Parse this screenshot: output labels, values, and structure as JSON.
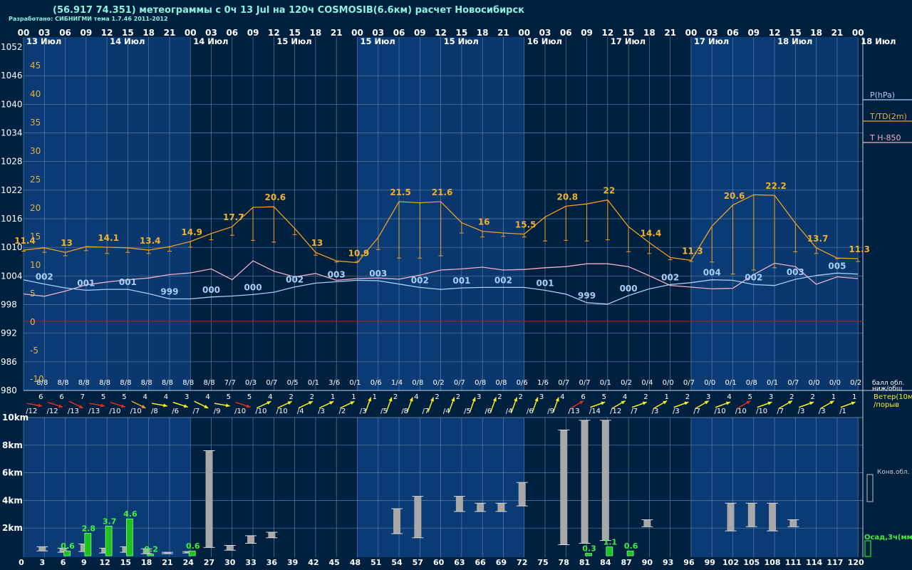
{
  "header": {
    "title": "(56.917 74.351) метеограммы с  0ч 13 Jul на 120ч COSMOSIB(6.6км) расчет Новосибирск",
    "credit": "Разработано: СИБНИГМИ тема 1.7.46 2011-2012"
  },
  "colors": {
    "background": "#00203f",
    "day_band": "#0b3b75",
    "grid": "#5b7fa5",
    "pressure": "#a8cef5",
    "temperature": "#f0a020",
    "t850": "#f0b0c8",
    "zero_line": "#a02020",
    "wind_arrow": "#f8f020",
    "wind_arrow_strong": "#e03020",
    "wind_arrow_mid": "#e8a020",
    "cloud_bar": "#a8a8a8",
    "precip_bar": "#20c020",
    "axis_text": "#ffffff",
    "pressure_label": "#a8d0f8",
    "temperature_label": "#f0b030"
  },
  "chart_data": {
    "type": "line",
    "x_hours": [
      0,
      3,
      6,
      9,
      12,
      15,
      18,
      21,
      24,
      27,
      30,
      33,
      36,
      39,
      42,
      45,
      48,
      51,
      54,
      57,
      60,
      63,
      66,
      69,
      72,
      75,
      78,
      81,
      84,
      87,
      90,
      93,
      96,
      99,
      102,
      105,
      108,
      111,
      114,
      117,
      120
    ],
    "time_ticks_top": [
      "00",
      "03",
      "06",
      "09",
      "12",
      "15",
      "18",
      "21",
      "00",
      "03",
      "06",
      "09",
      "12",
      "15",
      "18",
      "21",
      "00",
      "03",
      "06",
      "09",
      "12",
      "15",
      "18",
      "21",
      "00",
      "03",
      "06",
      "09",
      "12",
      "15",
      "18",
      "21",
      "00",
      "03",
      "06",
      "09",
      "12",
      "15",
      "18",
      "21",
      "00"
    ],
    "date_labels": [
      {
        "hour": 1.5,
        "text": "13 Июл"
      },
      {
        "hour": 13.5,
        "text": "14 Июл"
      },
      {
        "hour": 25.5,
        "text": "14 Июл"
      },
      {
        "hour": 37.5,
        "text": "15 Июл"
      },
      {
        "hour": 49.5,
        "text": "15 Июл"
      },
      {
        "hour": 61.5,
        "text": "15 Июл"
      },
      {
        "hour": 73.5,
        "text": "16 Июл"
      },
      {
        "hour": 85.5,
        "text": "17 Июл"
      },
      {
        "hour": 97.5,
        "text": "17 Июл"
      },
      {
        "hour": 109.5,
        "text": "18 Июл"
      },
      {
        "hour": 121.5,
        "text": "18 Июл"
      }
    ],
    "pressure_axis": {
      "min": 980,
      "max": 1052,
      "step": 6,
      "ticks": [
        "1052",
        "1046",
        "1040",
        "1034",
        "1028",
        "1022",
        "1016",
        "1010",
        "1004",
        "998",
        "992",
        "986",
        "980"
      ]
    },
    "temperature_axis": {
      "min": -10,
      "max": 45,
      "step": 5,
      "ticks": [
        "45",
        "40",
        "35",
        "30",
        "25",
        "20",
        "15",
        "10",
        "5",
        "0",
        "-5",
        "-10"
      ]
    },
    "legend": [
      "P(hPa)",
      "T/TD(2m)",
      "T H-850"
    ],
    "pressure_hPa": [
      1003.2,
      1002.3,
      1001.5,
      1001,
      1001.2,
      1001.2,
      1000.3,
      999.2,
      999.2,
      999.6,
      999.8,
      1000.1,
      1000.6,
      1001.7,
      1002.5,
      1002.8,
      1003.1,
      1003,
      1002.3,
      1001.6,
      1001.2,
      1001.5,
      1001.6,
      1001.6,
      1001.6,
      1001,
      1000.2,
      998.4,
      998.1,
      999.9,
      1001.3,
      1002.2,
      1002.6,
      1003.2,
      1003.1,
      1002.2,
      1002,
      1003.3,
      1004.1,
      1004.6,
      1004.4
    ],
    "pressure_labels": [
      {
        "hour": 3,
        "text": "002"
      },
      {
        "hour": 9,
        "text": "001"
      },
      {
        "hour": 15,
        "text": "001"
      },
      {
        "hour": 21,
        "text": "999"
      },
      {
        "hour": 27,
        "text": "000"
      },
      {
        "hour": 33,
        "text": "000"
      },
      {
        "hour": 39,
        "text": "002"
      },
      {
        "hour": 45,
        "text": "003"
      },
      {
        "hour": 51,
        "text": "003"
      },
      {
        "hour": 57,
        "text": "002"
      },
      {
        "hour": 63,
        "text": "001"
      },
      {
        "hour": 69,
        "text": "002"
      },
      {
        "hour": 75,
        "text": "001"
      },
      {
        "hour": 81,
        "text": "999"
      },
      {
        "hour": 87,
        "text": "000"
      },
      {
        "hour": 93,
        "text": "002"
      },
      {
        "hour": 99,
        "text": "004"
      },
      {
        "hour": 105,
        "text": "002"
      },
      {
        "hour": 111,
        "text": "003"
      },
      {
        "hour": 117,
        "text": "005"
      }
    ],
    "temperature_2m": [
      12.5,
      12.9,
      12.1,
      13.1,
      13.0,
      12.9,
      12.5,
      13.1,
      14.0,
      15.4,
      16.6,
      20.0,
      20.1,
      16.3,
      12.1,
      10.6,
      10.3,
      14.7,
      21.0,
      20.8,
      21.0,
      17.3,
      15.8,
      15.5,
      15.3,
      18.3,
      20.2,
      20.6,
      21.3,
      16.6,
      13.8,
      11.2,
      10.7,
      16.7,
      20.4,
      22.2,
      22.1,
      17.2,
      12.9,
      11.1,
      11.0
    ],
    "dewpoint_2m": [
      12.3,
      12.1,
      11.5,
      12.4,
      11.9,
      12.1,
      11.9,
      12.3,
      13.0,
      14.3,
      15.1,
      14.2,
      13.9,
      15.2,
      11.6,
      10.4,
      10.5,
      12.6,
      11.1,
      11.1,
      11.5,
      15.5,
      14.8,
      14.9,
      14.8,
      14.1,
      14.2,
      14.1,
      14.3,
      12.2,
      11.9,
      10.8,
      10.5,
      10.4,
      8.3,
      9.0,
      9.4,
      12.2,
      11.9,
      11.0,
      10.5
    ],
    "temperature_labels": [
      {
        "hour": 0,
        "text": "11.4"
      },
      {
        "hour": 6,
        "text": "13"
      },
      {
        "hour": 12,
        "text": "14.1"
      },
      {
        "hour": 18,
        "text": "13.4"
      },
      {
        "hour": 24,
        "text": "14.9"
      },
      {
        "hour": 30,
        "text": "17.7"
      },
      {
        "hour": 36,
        "text": "20.6"
      },
      {
        "hour": 42,
        "text": "13"
      },
      {
        "hour": 48,
        "text": "10.9"
      },
      {
        "hour": 54,
        "text": "21.5"
      },
      {
        "hour": 60,
        "text": "21.6"
      },
      {
        "hour": 66,
        "text": "16"
      },
      {
        "hour": 72,
        "text": "15.5"
      },
      {
        "hour": 78,
        "text": "20.8"
      },
      {
        "hour": 84,
        "text": "22"
      },
      {
        "hour": 90,
        "text": "14.4"
      },
      {
        "hour": 96,
        "text": "11.3"
      },
      {
        "hour": 102,
        "text": "20.6"
      },
      {
        "hour": 108,
        "text": "22.2"
      },
      {
        "hour": 114,
        "text": "13.7"
      },
      {
        "hour": 120,
        "text": "11.3"
      }
    ],
    "temperature_850": [
      4.8,
      4.4,
      5.3,
      6.4,
      6.9,
      7.3,
      7.6,
      8.2,
      8.5,
      9.2,
      7.3,
      10.6,
      8.8,
      7.8,
      8.4,
      7.2,
      7.5,
      7.6,
      7.4,
      8.1,
      9.0,
      9.2,
      9.5,
      9.0,
      9.1,
      9.4,
      9.6,
      10.1,
      10.1,
      9.6,
      8.0,
      6.3,
      6.0,
      5.7,
      5.8,
      8.2,
      10.2,
      9.6,
      6.5,
      7.8,
      7.5
    ],
    "cloud_cover": [
      "8/8",
      "8/8",
      "8/8",
      "8/8",
      "8/8",
      "8/8",
      "8/8",
      "8/8",
      "8/8",
      "8/8",
      "7/7",
      "0/3",
      "0/7",
      "0/5",
      "0/1",
      "3/6",
      "0/1",
      "0/6",
      "1/4",
      "0/8",
      "0/2",
      "0/7",
      "0/8",
      "0/8",
      "0/6",
      "1/6",
      "0/7",
      "0/7",
      "0/1",
      "0/2",
      "0/4",
      "0/0",
      "0/7",
      "0/0",
      "0/1",
      "0/8",
      "0/1",
      "0/7",
      "0/0",
      "0/0",
      "0/2"
    ],
    "cloud_label": "балл обл.\nниж/общ",
    "wind": [
      {
        "hour": 3,
        "speed": "6",
        "gust": "/12",
        "level": "strong"
      },
      {
        "hour": 6,
        "speed": "6",
        "gust": "/12",
        "level": "strong"
      },
      {
        "hour": 9,
        "speed": "7",
        "gust": "/13",
        "level": "strong"
      },
      {
        "hour": 12,
        "speed": "5",
        "gust": "/13",
        "level": "strong"
      },
      {
        "hour": 15,
        "speed": "5",
        "gust": "/10",
        "level": "strong"
      },
      {
        "hour": 18,
        "speed": "4",
        "gust": "/10",
        "level": "mid"
      },
      {
        "hour": 21,
        "speed": "4",
        "gust": "/8",
        "level": "normal"
      },
      {
        "hour": 24,
        "speed": "3",
        "gust": "/6",
        "level": "normal"
      },
      {
        "hour": 27,
        "speed": "4",
        "gust": "/7",
        "level": "normal"
      },
      {
        "hour": 30,
        "speed": "5",
        "gust": "/9",
        "level": "normal"
      },
      {
        "hour": 33,
        "speed": "5",
        "gust": "/10",
        "level": "strong"
      },
      {
        "hour": 36,
        "speed": "4",
        "gust": "/10",
        "level": "normal"
      },
      {
        "hour": 39,
        "speed": "2",
        "gust": "/10",
        "level": "normal"
      },
      {
        "hour": 42,
        "speed": "2",
        "gust": "/4",
        "level": "normal"
      },
      {
        "hour": 45,
        "speed": "1",
        "gust": "/3",
        "level": "normal"
      },
      {
        "hour": 48,
        "speed": "1",
        "gust": "/2",
        "level": "normal"
      },
      {
        "hour": 51,
        "speed": "1",
        "gust": "/3",
        "level": "normal"
      },
      {
        "hour": 54,
        "speed": "2",
        "gust": "/5",
        "level": "normal"
      },
      {
        "hour": 57,
        "speed": "4",
        "gust": "/8",
        "level": "normal"
      },
      {
        "hour": 60,
        "speed": "2",
        "gust": "/7",
        "level": "normal"
      },
      {
        "hour": 63,
        "speed": "2",
        "gust": "/4",
        "level": "normal"
      },
      {
        "hour": 66,
        "speed": "3",
        "gust": "/5",
        "level": "normal"
      },
      {
        "hour": 69,
        "speed": "2",
        "gust": "/6",
        "level": "normal"
      },
      {
        "hour": 72,
        "speed": "2",
        "gust": "/4",
        "level": "normal"
      },
      {
        "hour": 75,
        "speed": "3",
        "gust": "/6",
        "level": "normal"
      },
      {
        "hour": 78,
        "speed": "4",
        "gust": "/9",
        "level": "normal"
      },
      {
        "hour": 81,
        "speed": "6",
        "gust": "/13",
        "level": "strong"
      },
      {
        "hour": 84,
        "speed": "5",
        "gust": "/14",
        "level": "normal"
      },
      {
        "hour": 87,
        "speed": "4",
        "gust": "/12",
        "level": "normal"
      },
      {
        "hour": 90,
        "speed": "2",
        "gust": "/7",
        "level": "normal"
      },
      {
        "hour": 93,
        "speed": "1",
        "gust": "/3",
        "level": "normal"
      },
      {
        "hour": 96,
        "speed": "2",
        "gust": "/3",
        "level": "normal"
      },
      {
        "hour": 99,
        "speed": "3",
        "gust": "/7",
        "level": "normal"
      },
      {
        "hour": 102,
        "speed": "4",
        "gust": "/10",
        "level": "normal"
      },
      {
        "hour": 105,
        "speed": "5",
        "gust": "/10",
        "level": "strong"
      },
      {
        "hour": 108,
        "speed": "3",
        "gust": "/10",
        "level": "normal"
      },
      {
        "hour": 111,
        "speed": "2",
        "gust": "/7",
        "level": "normal"
      },
      {
        "hour": 114,
        "speed": "2",
        "gust": "/3",
        "level": "normal"
      },
      {
        "hour": 117,
        "speed": "1",
        "gust": "/3",
        "level": "normal"
      },
      {
        "hour": 120,
        "speed": "1",
        "gust": "/1",
        "level": "normal"
      }
    ],
    "wind_label": "Ветер(10м)\n/порыв",
    "height_axis": {
      "min": 0,
      "max": 10,
      "unit": "km",
      "ticks": [
        "10km",
        "8km",
        "6km",
        "4km",
        "2km"
      ]
    },
    "convective_cloud_label": "Конв.обл.",
    "precip_label": "Осад,3ч(мм)",
    "bottom_hour_labels": [
      "0",
      "3",
      "6",
      "9",
      "12",
      "15",
      "18",
      "21",
      "24",
      "27",
      "30",
      "33",
      "36",
      "39",
      "42",
      "45",
      "48",
      "51",
      "54",
      "57",
      "60",
      "63",
      "66",
      "69",
      "72",
      "75",
      "78",
      "81",
      "84",
      "87",
      "90",
      "93",
      "96",
      "99",
      "102",
      "105",
      "108",
      "111",
      "114",
      "117",
      "120"
    ],
    "convective_clouds_km": [
      {
        "hour": 3,
        "base": 0.35,
        "top": 0.65
      },
      {
        "hour": 6,
        "base": 0.25,
        "top": 0.55
      },
      {
        "hour": 9,
        "base": 0.3,
        "top": 0.85
      },
      {
        "hour": 12,
        "base": 0.2,
        "top": 0.55
      },
      {
        "hour": 15,
        "base": 0.25,
        "top": 0.65
      },
      {
        "hour": 18,
        "base": 0.15,
        "top": 0.5
      },
      {
        "hour": 21,
        "base": 0.15,
        "top": 0.25
      },
      {
        "hour": 24,
        "base": 0.2,
        "top": 0.3
      },
      {
        "hour": 27,
        "base": 0.6,
        "top": 7.6
      },
      {
        "hour": 30,
        "base": 0.4,
        "top": 0.75
      },
      {
        "hour": 33,
        "base": 0.9,
        "top": 1.45
      },
      {
        "hour": 36,
        "base": 1.3,
        "top": 1.7
      },
      {
        "hour": 54,
        "base": 1.6,
        "top": 3.4
      },
      {
        "hour": 57,
        "base": 1.3,
        "top": 4.3
      },
      {
        "hour": 63,
        "base": 3.2,
        "top": 4.3
      },
      {
        "hour": 66,
        "base": 3.2,
        "top": 3.8
      },
      {
        "hour": 69,
        "base": 3.2,
        "top": 3.8
      },
      {
        "hour": 72,
        "base": 3.6,
        "top": 5.3
      },
      {
        "hour": 78,
        "base": 0.8,
        "top": 9.1
      },
      {
        "hour": 81,
        "base": 0.9,
        "top": 9.8
      },
      {
        "hour": 84,
        "base": 1.1,
        "top": 9.8
      },
      {
        "hour": 90,
        "base": 2.1,
        "top": 2.6
      },
      {
        "hour": 102,
        "base": 1.8,
        "top": 3.8
      },
      {
        "hour": 105,
        "base": 2.1,
        "top": 3.8
      },
      {
        "hour": 108,
        "base": 1.8,
        "top": 3.8
      },
      {
        "hour": 111,
        "base": 2.1,
        "top": 2.6
      }
    ],
    "precipitation_mm": [
      {
        "hour": 6,
        "value": 0.6
      },
      {
        "hour": 9,
        "value": 2.8
      },
      {
        "hour": 12,
        "value": 3.7
      },
      {
        "hour": 15,
        "value": 4.6
      },
      {
        "hour": 18,
        "value": 0.2
      },
      {
        "hour": 24,
        "value": 0.6
      },
      {
        "hour": 81,
        "value": 0.3
      },
      {
        "hour": 84,
        "value": 1.1
      },
      {
        "hour": 87,
        "value": 0.6
      }
    ]
  }
}
